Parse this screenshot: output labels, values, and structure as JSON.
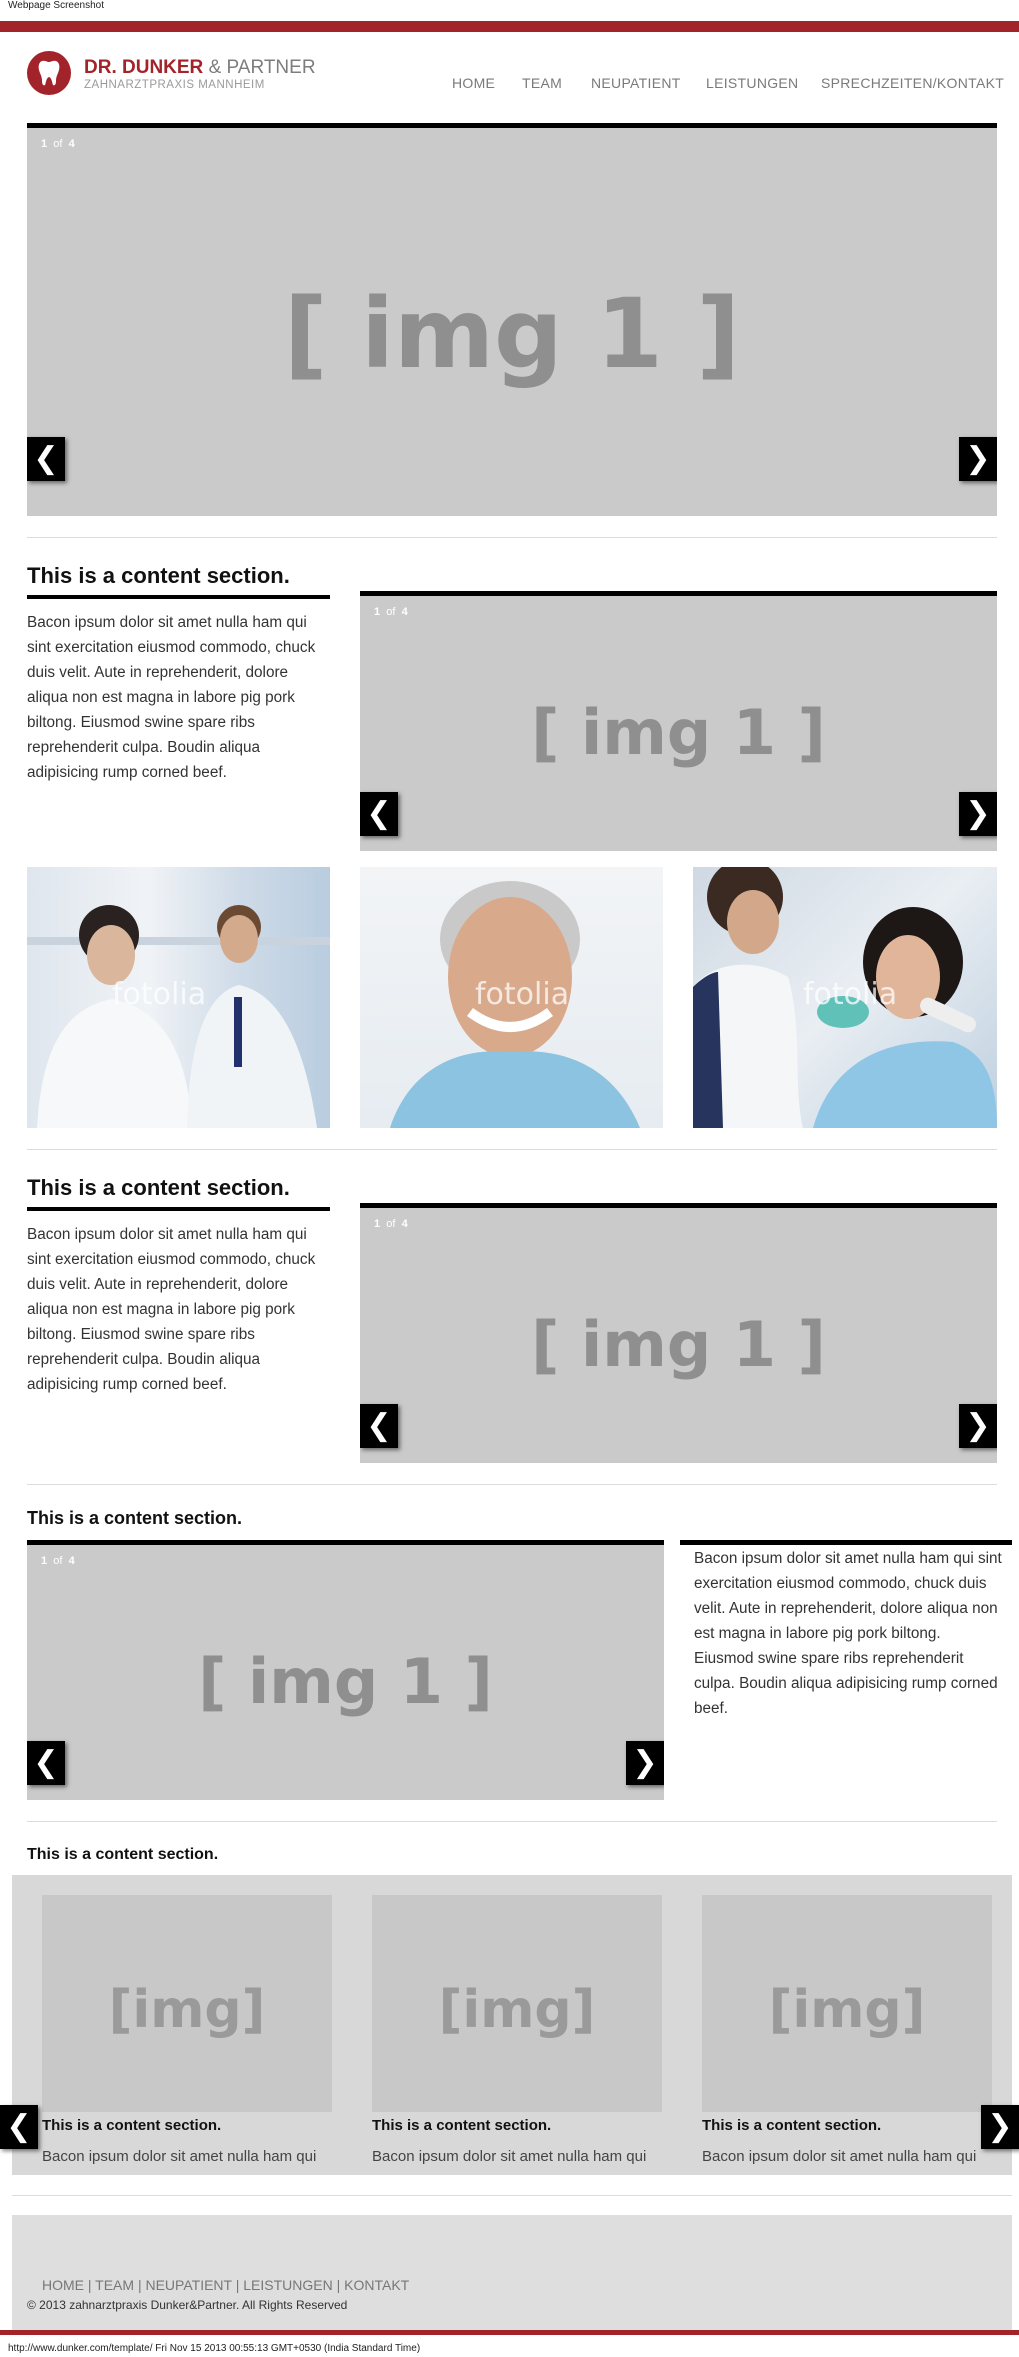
{
  "caption": "Webpage Screenshot",
  "brand": {
    "name_red": "DR. DUNKER",
    "name_grey": "& PARTNER",
    "subtitle": "ZAHNARZTPRAXIS MANNHEIM",
    "color": "#a3232a"
  },
  "nav": [
    "HOME",
    "TEAM",
    "NEUPATIENT",
    "LEISTUNGEN",
    "SPRECHZEITEN/KONTAKT"
  ],
  "slider": {
    "counter_current": "1",
    "counter_of": "of",
    "counter_total": "4",
    "placeholder": "[ img 1 ]",
    "prev": "❮",
    "next": "❯"
  },
  "sections": [
    {
      "title": "This is a content section.",
      "text": "Bacon ipsum dolor sit amet nulla ham qui sint exercitation eiusmod commodo, chuck duis velit. Aute in reprehenderit, dolore aliqua non est magna in labore pig pork biltong. Eiusmod swine spare ribs reprehenderit culpa. Boudin aliqua adipisicing rump corned beef."
    },
    {
      "title": "This is a content section.",
      "text": "Bacon ipsum dolor sit amet nulla ham qui sint exercitation eiusmod commodo, chuck duis velit. Aute in reprehenderit, dolore aliqua non est magna in labore pig pork biltong. Eiusmod swine spare ribs reprehenderit culpa. Boudin aliqua adipisicing rump corned beef."
    },
    {
      "title": "This is a content section.",
      "text": "Bacon ipsum dolor sit amet nulla ham qui sint exercitation eiusmod commodo, chuck duis velit. Aute in reprehenderit, dolore aliqua non est magna in labore pig pork biltong. Eiusmod swine spare ribs reprehenderit culpa. Boudin aliqua adipisicing rump corned beef."
    },
    {
      "title": "This is a content section."
    }
  ],
  "photos": [
    {
      "watermark": "fotolia",
      "subject": "two-dentists-photo"
    },
    {
      "watermark": "fotolia",
      "subject": "smiling-man-photo"
    },
    {
      "watermark": "fotolia",
      "subject": "dental-treatment-photo"
    }
  ],
  "cards": [
    {
      "placeholder": "[img]",
      "title": "This is a content section.",
      "text": "Bacon ipsum dolor sit amet nulla ham qui"
    },
    {
      "placeholder": "[img]",
      "title": "This is a content section.",
      "text": "Bacon ipsum dolor sit amet nulla ham qui"
    },
    {
      "placeholder": "[img]",
      "title": "This is a content section.",
      "text": "Bacon ipsum dolor sit amet nulla ham qui"
    }
  ],
  "footer": {
    "links": [
      "HOME",
      "TEAM",
      "NEUPATIENT",
      "LEISTUNGEN",
      "KONTAKT"
    ],
    "separator": "|",
    "copyright": "© 2013 zahnarztpraxis Dunker&Partner. All Rights Reserved"
  },
  "status_line": "http://www.dunker.com/template/ Fri Nov 15 2013 00:55:13 GMT+0530 (India Standard Time)"
}
